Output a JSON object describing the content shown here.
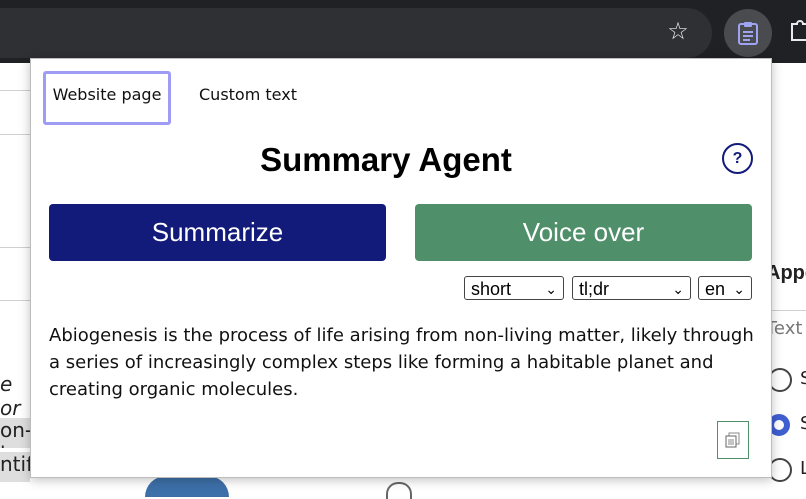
{
  "popup": {
    "tabs": [
      {
        "label": "Website page",
        "active": true
      },
      {
        "label": "Custom text",
        "active": false
      }
    ],
    "title": "Summary Agent",
    "help_label": "?",
    "buttons": {
      "summarize": "Summarize",
      "voice_over": "Voice over"
    },
    "selects": {
      "length": "short",
      "format": "tl;dr",
      "language": "en"
    },
    "summary_text": "Abiogenesis is the process of life arising from non-living matter, likely through a series of increasingly complex steps like forming a habitable planet and creating organic molecules."
  },
  "background_page": {
    "heading_fragment": "Appe",
    "text_fragment": "Text",
    "italic_fragment": "e or",
    "left_fragments": [
      "on-l",
      "ntif"
    ],
    "radio_labels": [
      "S",
      "S",
      "L"
    ]
  },
  "colors": {
    "primary": "#121a7a",
    "voice": "#4f8f6a",
    "tab_focus": "#9e9cf5",
    "toolbar": "#202124"
  },
  "icons": {
    "bookmark": "star-icon",
    "extension": "clipboard-icon",
    "extensions_menu": "puzzle-icon",
    "copy": "copy-icon"
  }
}
